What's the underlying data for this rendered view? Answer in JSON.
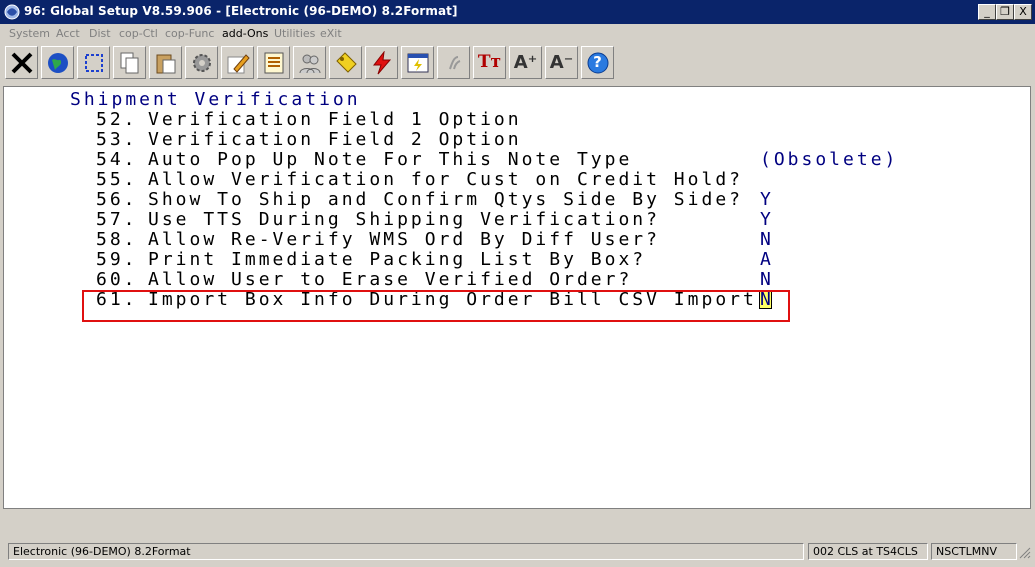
{
  "window": {
    "title": "96: Global Setup V8.59.906 - [Electronic (96-DEMO) 8.2Format]",
    "controls": {
      "minimize": "_",
      "restore": "❐",
      "close": "X"
    }
  },
  "menu": [
    "System",
    "Acct",
    "Dist",
    "cop-Ctl",
    "cop-Func",
    "add-Ons",
    "Utilities",
    "eXit"
  ],
  "toolbar": {
    "text_icons": {
      "font_style": "Tт",
      "font_bigger": "A⁺",
      "font_smaller": "A⁻",
      "help": "?"
    }
  },
  "screen": {
    "section_title": "Shipment Verification",
    "rows": [
      {
        "num": "52.",
        "label": "Verification Field 1 Option",
        "value": ""
      },
      {
        "num": "53.",
        "label": "Verification Field 2 Option",
        "value": ""
      },
      {
        "num": "54.",
        "label": "Auto Pop Up Note For This Note Type",
        "value": "(Obsolete)"
      },
      {
        "num": "55.",
        "label": "Allow Verification for Cust on Credit Hold?",
        "value": ""
      },
      {
        "num": "56.",
        "label": "Show To Ship and Confirm Qtys Side By Side?",
        "value": "Y"
      },
      {
        "num": "57.",
        "label": "Use TTS During Shipping Verification?",
        "value": "Y"
      },
      {
        "num": "58.",
        "label": "Allow Re-Verify WMS Ord By Diff User?",
        "value": "N"
      },
      {
        "num": "59.",
        "label": "Print Immediate Packing List By Box?",
        "value": "A"
      },
      {
        "num": "60.",
        "label": "Allow User to Erase Verified Order?",
        "value": "N"
      },
      {
        "num": "61.",
        "label": "Import Box Info During Order Bill CSV Import?",
        "value": "N"
      }
    ]
  },
  "status": {
    "company": "Electronic (96-DEMO) 8.2Format",
    "session": "002 CLS at TS4CLS",
    "program": "NSCTLMNV"
  },
  "colors": {
    "title_bar": "#0a246a",
    "value_text": "#000080",
    "highlight_border": "#e01010",
    "cursor_bg": "#ffff66"
  }
}
